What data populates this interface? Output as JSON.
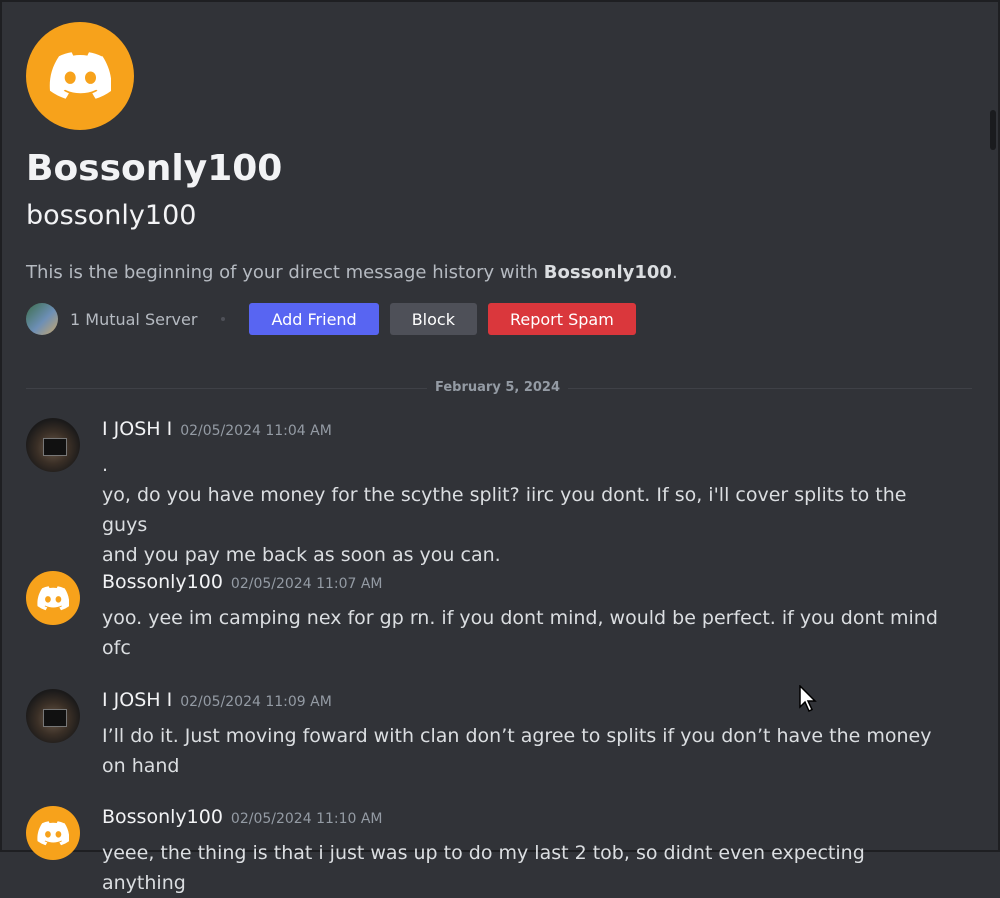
{
  "profile": {
    "display_name": "Bossonly100",
    "username": "bossonly100",
    "intro_prefix": "This is the beginning of your direct message history with ",
    "intro_name": "Bossonly100",
    "intro_suffix": ".",
    "mutual_servers": "1 Mutual Server",
    "avatar_color": "#f7a21b"
  },
  "actions": {
    "add_friend": "Add Friend",
    "block": "Block",
    "report_spam": "Report Spam"
  },
  "date_divider": "February 5, 2024",
  "messages": [
    {
      "author": "I JOSH I",
      "time": "02/05/2024 11:04 AM",
      "lines": [
        ".",
        "yo, do you have money for the scythe split? iirc you dont. If so, i'll cover splits to the guys",
        "and you pay me back as soon as you can."
      ]
    },
    {
      "author": "Bossonly100",
      "time": "02/05/2024 11:07 AM",
      "lines": [
        "yoo.  yee im camping nex for gp rn. if you dont mind, would be perfect. if you dont mind",
        "ofc"
      ]
    },
    {
      "author": "I JOSH I",
      "time": "02/05/2024 11:09 AM",
      "lines": [
        "I’ll do it. Just moving foward with clan don’t agree to splits if you don’t have the money",
        "on hand"
      ]
    },
    {
      "author": "Bossonly100",
      "time": "02/05/2024 11:10 AM",
      "lines": [
        "yeee, the thing is that i just was up to do my last 2 tob, so didnt even expecting anything"
      ]
    }
  ],
  "colors": {
    "background": "#313338",
    "blurple": "#5865f2",
    "danger": "#da373c",
    "secondary": "#4e5058"
  }
}
